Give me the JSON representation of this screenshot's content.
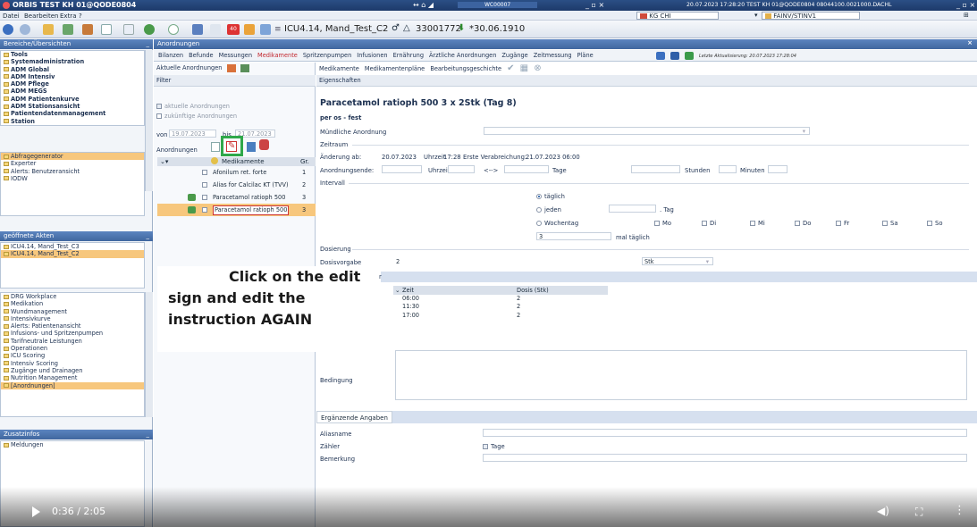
{
  "titlebar": {
    "title": "ORBIS TEST KH 01@QODE0804",
    "center_badge": "WC00007",
    "right_info": "20.07.2023 17:28:20    TEST KH 01@QODE0804 08044100.0021000.DACHL"
  },
  "menubar": {
    "items": [
      "Datei",
      "Bearbeiten",
      "Extra",
      "?"
    ],
    "right_box1": "KG CHI",
    "right_box2": "FAINV/STINV1"
  },
  "toolbar": {
    "patient": "ICU4.14, Mand_Test_C2",
    "case_no": "33001772",
    "birth": "*30.06.1910",
    "badge": "40"
  },
  "left": {
    "sec1_title": "Bereiche/Übersichten",
    "list1": [
      {
        "label": "Tools",
        "bold": true
      },
      {
        "label": "Systemadministration",
        "bold": true
      },
      {
        "label": "ADM Global",
        "bold": true
      },
      {
        "label": "ADM Intensiv",
        "bold": true
      },
      {
        "label": "ADM Pflege",
        "bold": true
      },
      {
        "label": "ADM MEGS",
        "bold": true
      },
      {
        "label": "ADM Patientenkurve",
        "bold": true
      },
      {
        "label": "ADM Stationsansicht",
        "bold": true
      },
      {
        "label": "Patientendatenmanagement",
        "bold": true
      },
      {
        "label": "Station",
        "bold": true
      }
    ],
    "list2": [
      "Abfragegenerator",
      "Experter",
      "Alerts: Benutzeransicht",
      "IODW"
    ],
    "sec2_title": "geöffnete Akten",
    "list3": [
      "ICU4.14, Mand_Test_C3",
      "ICU4.14, Mand_Test_C2"
    ],
    "list4": [
      "DRG Workplace",
      "Medikation",
      "Wundmanagement",
      "Intensivkurve",
      "Alerts: Patientenansicht",
      "Infusions- und Spritzenpumpen",
      "Tarifneutrale Leistungen",
      "Operationen",
      "ICU Scoring",
      "Intensiv Scoring",
      "Zugänge und Drainagen",
      "Nutrition Management",
      "[Anordnungen]"
    ],
    "sec3_title": "Zusatzinfos",
    "list5": [
      "Meldungen"
    ]
  },
  "main": {
    "header": "Anordnungen",
    "tabs": [
      "Bilanzen",
      "Befunde",
      "Messungen",
      "Medikamente",
      "Spritzenpumpen",
      "Infusionen",
      "Ernährung",
      "Ärztliche Anordnungen",
      "Zugänge",
      "Zeitmessung",
      "Pläne"
    ],
    "last_update": "Letzte Aktualisierung: 20.07.2023 17:28:04"
  },
  "col2": {
    "title": "Aktuelle Anordnungen",
    "filter_label": "Filter",
    "opt_current": "aktuelle Anordnungen",
    "opt_future": "zukünftige Anordnungen",
    "von_label": "von",
    "von_value": "19.07.2023",
    "bis_label": "bis",
    "bis_value": "21.07.2023",
    "list_label": "Anordnungen",
    "col_med": "Medikamente",
    "col_gr": "Gr.",
    "rows": [
      {
        "name": "Afonilum ret. forte",
        "gr": "1"
      },
      {
        "name": "Alias for Calcilac KT (TVV)",
        "gr": "2"
      },
      {
        "name": "Paracetamol ratioph 500",
        "gr": "3"
      },
      {
        "name": "Paracetamol ratioph 500",
        "gr": "3"
      }
    ]
  },
  "col3": {
    "subtabs": [
      "Medikamente",
      "Medikamentenpläne",
      "Bearbeitungsgeschichte"
    ],
    "props_tab": "Eigenschaften",
    "drug_title": "Paracetamol ratioph 500  3 x 2Stk (Tag 8)",
    "route": "per os - fest",
    "oral_label": "Mündliche Anordnung",
    "zeitraum": "Zeitraum",
    "aend_label": "Änderung ab:",
    "aend_date": "20.07.2023",
    "uhrzeit": "Uhrzeit",
    "aend_time": "17:28",
    "erste_label": "Erste Verabreichung:",
    "erste_value": "21.07.2023 06:00",
    "ende_label": "Anordnungsende:",
    "arrow": "<-->",
    "tage": "Tage",
    "stunden": "Stunden",
    "minuten": "Minuten",
    "intervall": "Intervall",
    "r_daily": "täglich",
    "r_every": "jeden",
    "tag": ". Tag",
    "r_weekday": "Wochentag",
    "weekdays": [
      "Mo",
      "Di",
      "Mi",
      "Do",
      "Fr",
      "Sa",
      "So"
    ],
    "times_value": "3",
    "times_label": "mal täglich",
    "dosierung": "Dosierung",
    "dosis_label": "Dosisvorgabe",
    "dosis_value": "2",
    "unit": "Stk",
    "dose_head_time": "Zeit",
    "dose_head_dose": "Dosis (Stk)",
    "dose_rows": [
      {
        "time": "06:00",
        "dose": "2"
      },
      {
        "time": "11:30",
        "dose": "2"
      },
      {
        "time": "17:00",
        "dose": "2"
      }
    ],
    "bedingung": "Bedingung",
    "ergaenzende": "Ergänzende Angaben",
    "alias": "Aliasname",
    "zaehler": "Zähler",
    "zaehler_cb": "Tage",
    "bemerkung": "Bemerkung"
  },
  "annotation": {
    "line1": "Click on the edit",
    "line2": "sign and edit the",
    "line3": "instruction AGAIN"
  },
  "player": {
    "time": "0:36 / 2:05"
  }
}
